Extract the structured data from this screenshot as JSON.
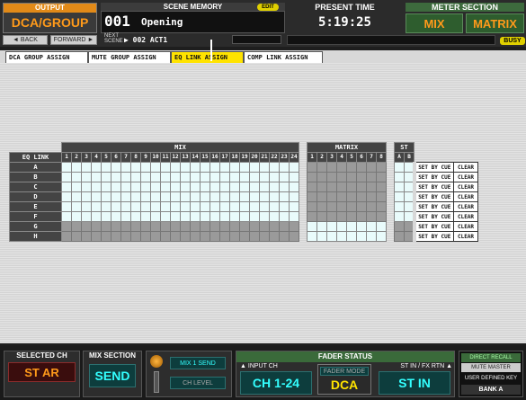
{
  "header": {
    "output_label": "OUTPUT",
    "dca_label": "DCA/GROUP",
    "back_label": "◄ BACK",
    "forward_label": "FORWARD ►",
    "scene_memory_label": "SCENE MEMORY",
    "edit_label": "EDIT",
    "scene_number": "001",
    "scene_title": "Opening",
    "next_label": "NEXT SCENE",
    "next_scene": "▶ 002 ACT1",
    "present_time_label": "PRESENT TIME",
    "present_time": "5:19:25",
    "meter_section_label": "METER SECTION",
    "mix_label": "MIX",
    "matrix_label": "MATRIX",
    "busy_label": "BUSY"
  },
  "tabs": [
    {
      "label": "DCA GROUP ASSIGN"
    },
    {
      "label": "MUTE GROUP ASSIGN"
    },
    {
      "label": "EQ LINK ASSIGN"
    },
    {
      "label": "COMP LINK ASSIGN"
    }
  ],
  "grid": {
    "corner_label": "EQ LINK",
    "mix_label": "MIX",
    "matrix_label": "MATRIX",
    "st_label": "ST",
    "mix_numbers": [
      "1",
      "2",
      "3",
      "4",
      "5",
      "6",
      "7",
      "8",
      "9",
      "10",
      "11",
      "12",
      "13",
      "14",
      "15",
      "16",
      "17",
      "18",
      "19",
      "20",
      "21",
      "22",
      "23",
      "24"
    ],
    "matrix_numbers": [
      "1",
      "2",
      "3",
      "4",
      "5",
      "6",
      "7",
      "8"
    ],
    "st_numbers": [
      "A",
      "B"
    ],
    "set_by_cue_label": "SET BY CUE",
    "clear_label": "CLEAR",
    "rows": [
      {
        "label": "A",
        "mix_on": true,
        "matrix_on": false,
        "st_on": true
      },
      {
        "label": "B",
        "mix_on": true,
        "matrix_on": false,
        "st_on": true
      },
      {
        "label": "C",
        "mix_on": true,
        "matrix_on": false,
        "st_on": true
      },
      {
        "label": "D",
        "mix_on": true,
        "matrix_on": false,
        "st_on": true
      },
      {
        "label": "E",
        "mix_on": true,
        "matrix_on": false,
        "st_on": true
      },
      {
        "label": "F",
        "mix_on": true,
        "matrix_on": false,
        "st_on": true
      },
      {
        "label": "G",
        "mix_on": false,
        "matrix_on": true,
        "st_on": false
      },
      {
        "label": "H",
        "mix_on": false,
        "matrix_on": true,
        "st_on": false
      }
    ]
  },
  "footer": {
    "selected_ch_label": "SELECTED CH",
    "selected_ch_value": "ST AR",
    "mix_section_label": "MIX SECTION",
    "mix_section_value": "SEND",
    "mix1_send_label": "MIX 1 SEND",
    "ch_level_label": "CH LEVEL",
    "fader_status_label": "FADER STATUS",
    "input_ch_label": "▲ INPUT CH",
    "input_ch_value": "CH 1-24",
    "fader_mode_label": "FADER MODE",
    "fader_mode_value": "DCA",
    "st_in_label": "ST IN / FX RTN ▲",
    "st_in_value": "ST IN",
    "direct_recall_label": "DIRECT RECALL",
    "mute_master_label": "MUTE MASTER",
    "user_defined_label": "USER DEFINED KEY",
    "bank_label": "BANK A"
  },
  "colors": {
    "accent_orange": "#ff9a1a",
    "active_tab_yellow": "#ffe300",
    "cell_on": "#e9fbfb",
    "cell_off": "#9a9a9a",
    "cyan_text": "#33ffff"
  },
  "icons": {
    "back": "left-triangle-icon",
    "forward": "right-triangle-icon",
    "knob": "rotary-knob-icon"
  }
}
